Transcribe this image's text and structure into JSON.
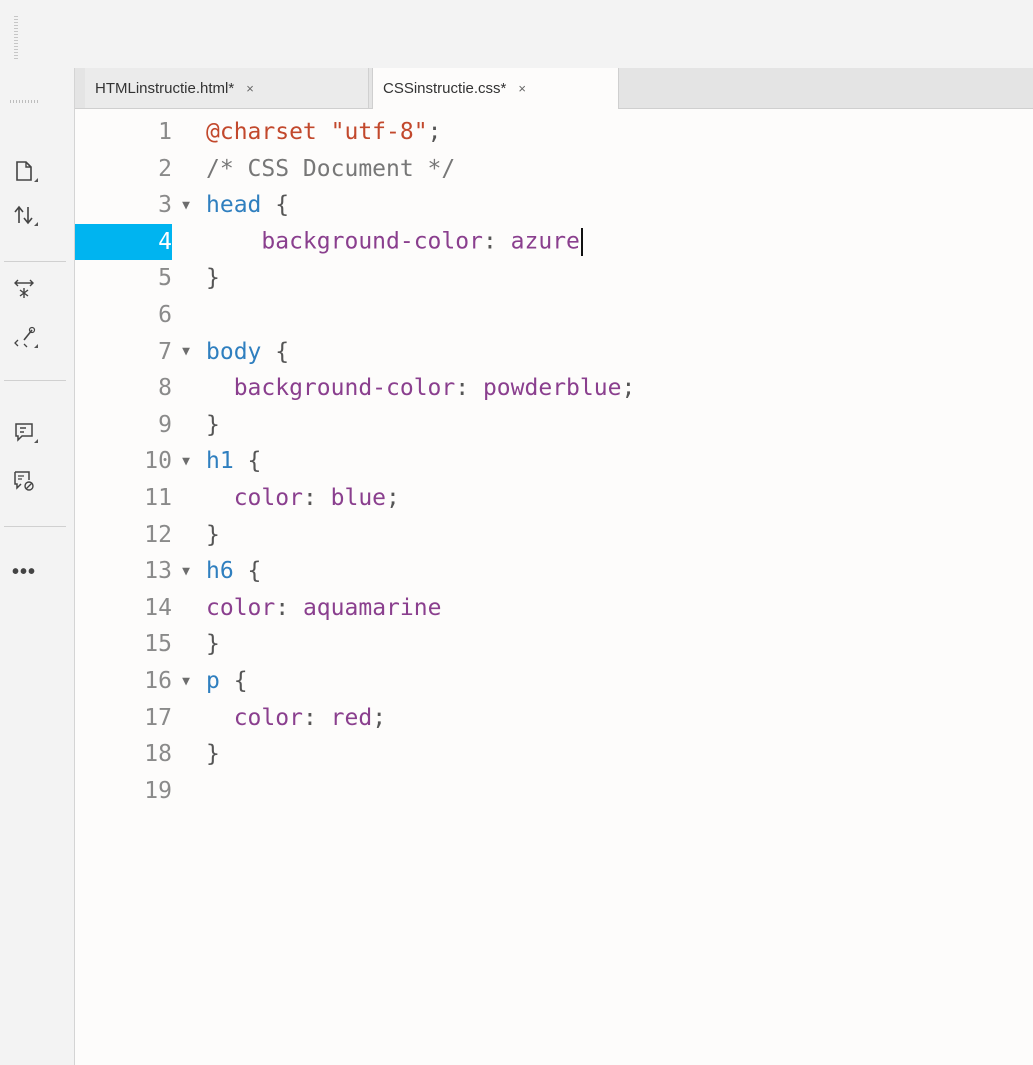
{
  "tabs": [
    {
      "label": "HTMLinstructie.html*",
      "close": "×",
      "active": false
    },
    {
      "label": "CSSinstructie.css*",
      "close": "×",
      "active": true
    }
  ],
  "toolbar_icons": [
    "new-document-icon",
    "sort-arrows-icon",
    "collapse-expand-icon",
    "wand-brackets-icon",
    "comment-icon",
    "remove-comment-icon",
    "more-icon"
  ],
  "more_label": "•••",
  "colors": {
    "active_line": "#00b4f0",
    "selector": "#2f7fbf",
    "property": "#8a3f8e",
    "at_rule": "#c2482c"
  },
  "editor": {
    "active_line": 4,
    "lines": [
      {
        "n": "1",
        "fold": "",
        "tokens": [
          {
            "c": "t-at",
            "t": "@charset "
          },
          {
            "c": "t-str",
            "t": "\"utf-8\""
          },
          {
            "c": "t-punc",
            "t": ";"
          }
        ]
      },
      {
        "n": "2",
        "fold": "",
        "tokens": [
          {
            "c": "t-comment",
            "t": "/* CSS Document */"
          }
        ]
      },
      {
        "n": "3",
        "fold": "▼",
        "tokens": [
          {
            "c": "t-sel",
            "t": "head "
          },
          {
            "c": "t-brace",
            "t": "{"
          }
        ]
      },
      {
        "n": "4",
        "fold": "",
        "tokens": [
          {
            "c": "t-prop",
            "t": "    background-color"
          },
          {
            "c": "t-punc",
            "t": ": "
          },
          {
            "c": "t-val",
            "t": "azure"
          }
        ],
        "cursor": true
      },
      {
        "n": "5",
        "fold": "",
        "tokens": [
          {
            "c": "t-brace",
            "t": "}"
          }
        ]
      },
      {
        "n": "6",
        "fold": "",
        "tokens": []
      },
      {
        "n": "7",
        "fold": "▼",
        "tokens": [
          {
            "c": "t-sel",
            "t": "body "
          },
          {
            "c": "t-brace",
            "t": "{"
          }
        ]
      },
      {
        "n": "8",
        "fold": "",
        "tokens": [
          {
            "c": "t-prop",
            "t": "  background-color"
          },
          {
            "c": "t-punc",
            "t": ": "
          },
          {
            "c": "t-val",
            "t": "powderblue"
          },
          {
            "c": "t-punc",
            "t": ";"
          }
        ]
      },
      {
        "n": "9",
        "fold": "",
        "tokens": [
          {
            "c": "t-brace",
            "t": "}"
          }
        ]
      },
      {
        "n": "10",
        "fold": "▼",
        "tokens": [
          {
            "c": "t-sel",
            "t": "h1 "
          },
          {
            "c": "t-brace",
            "t": "{"
          }
        ]
      },
      {
        "n": "11",
        "fold": "",
        "tokens": [
          {
            "c": "t-prop",
            "t": "  color"
          },
          {
            "c": "t-punc",
            "t": ": "
          },
          {
            "c": "t-val",
            "t": "blue"
          },
          {
            "c": "t-punc",
            "t": ";"
          }
        ]
      },
      {
        "n": "12",
        "fold": "",
        "tokens": [
          {
            "c": "t-brace",
            "t": "}"
          }
        ]
      },
      {
        "n": "13",
        "fold": "▼",
        "tokens": [
          {
            "c": "t-sel",
            "t": "h6 "
          },
          {
            "c": "t-brace",
            "t": "{"
          }
        ]
      },
      {
        "n": "14",
        "fold": "",
        "tokens": [
          {
            "c": "t-prop",
            "t": "color"
          },
          {
            "c": "t-punc",
            "t": ": "
          },
          {
            "c": "t-val",
            "t": "aquamarine"
          }
        ]
      },
      {
        "n": "15",
        "fold": "",
        "tokens": [
          {
            "c": "t-brace",
            "t": "}"
          }
        ]
      },
      {
        "n": "16",
        "fold": "▼",
        "tokens": [
          {
            "c": "t-sel",
            "t": "p "
          },
          {
            "c": "t-brace",
            "t": "{"
          }
        ]
      },
      {
        "n": "17",
        "fold": "",
        "tokens": [
          {
            "c": "t-prop",
            "t": "  color"
          },
          {
            "c": "t-punc",
            "t": ": "
          },
          {
            "c": "t-val",
            "t": "red"
          },
          {
            "c": "t-punc",
            "t": ";"
          }
        ]
      },
      {
        "n": "18",
        "fold": "",
        "tokens": [
          {
            "c": "t-brace",
            "t": "}"
          }
        ]
      },
      {
        "n": "19",
        "fold": "",
        "tokens": []
      }
    ]
  }
}
